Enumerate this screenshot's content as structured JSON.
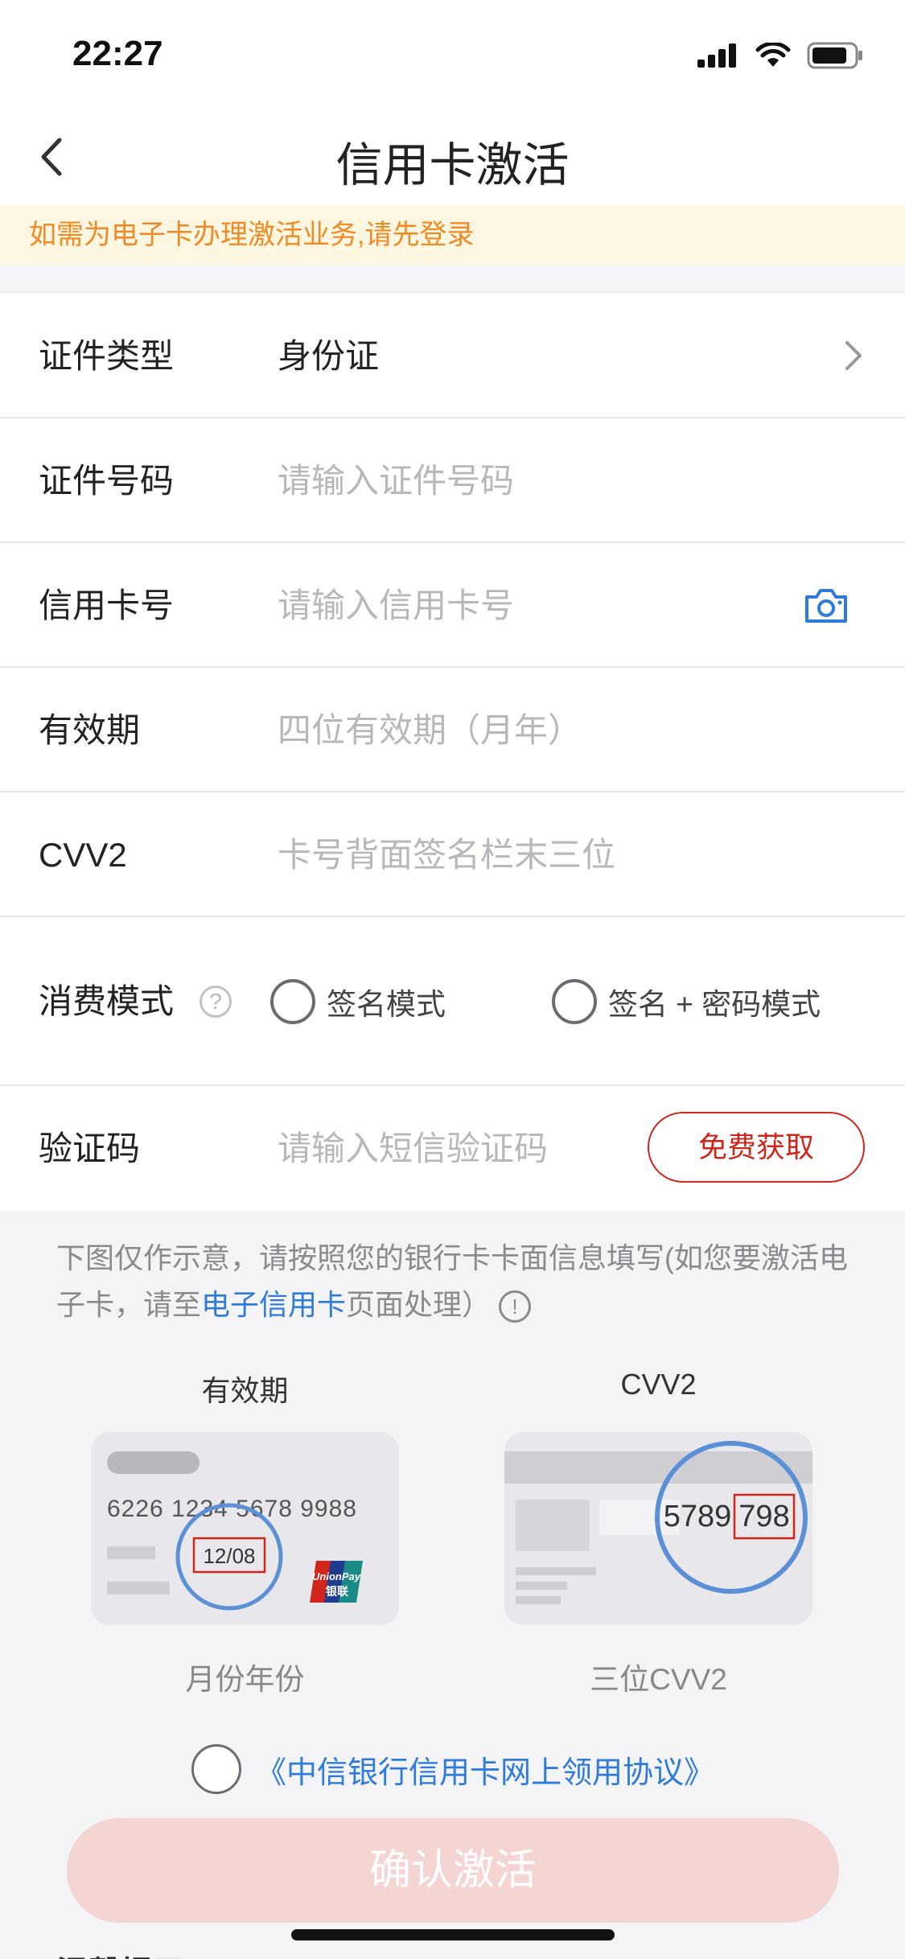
{
  "status": {
    "time": "22:27"
  },
  "nav": {
    "title": "信用卡激活"
  },
  "notice": {
    "text": "如需为电子卡办理激活业务,请先登录"
  },
  "form": {
    "id_type": {
      "label": "证件类型",
      "value": "身份证"
    },
    "id_number": {
      "label": "证件号码",
      "placeholder": "请输入证件号码"
    },
    "card_number": {
      "label": "信用卡号",
      "placeholder": "请输入信用卡号"
    },
    "expiry": {
      "label": "有效期",
      "placeholder": "四位有效期（月年）"
    },
    "cvv": {
      "label": "CVV2",
      "placeholder": "卡号背面签名栏末三位"
    },
    "mode": {
      "label": "消费模式",
      "help_glyph": "?",
      "options": [
        "签名模式",
        "签名 + 密码模式"
      ]
    },
    "sms": {
      "label": "验证码",
      "placeholder": "请输入短信验证码",
      "button": "免费获取"
    }
  },
  "hint": {
    "part1": "下图仅作示意，请按照您的银行卡卡面信息填写(如您要激活电子卡，请至",
    "link": "电子信用卡",
    "part2": "页面处理）",
    "info_glyph": "!"
  },
  "cards": {
    "front": {
      "title": "有效期",
      "number": "6226 1234 5678 9988",
      "expiry": "12/08",
      "brand_top": "UnionPay",
      "brand_bottom": "银联",
      "caption": "月份年份"
    },
    "back": {
      "title": "CVV2",
      "digits_left": "5789",
      "digits_right": "798",
      "caption": "三位CVV2"
    }
  },
  "agreement": {
    "text": "《中信银行信用卡网上领用协议》"
  },
  "confirm": {
    "label": "确认激活"
  },
  "tip": {
    "label": "温馨提示"
  },
  "colors": {
    "accent_red": "#d0251b",
    "link_blue": "#2f7bdc",
    "notice_orange": "#f08a24"
  },
  "icons": [
    "back-chevron-icon",
    "signal-icon",
    "wifi-icon",
    "battery-icon",
    "chevron-right-icon",
    "camera-icon",
    "help-icon",
    "info-icon"
  ]
}
